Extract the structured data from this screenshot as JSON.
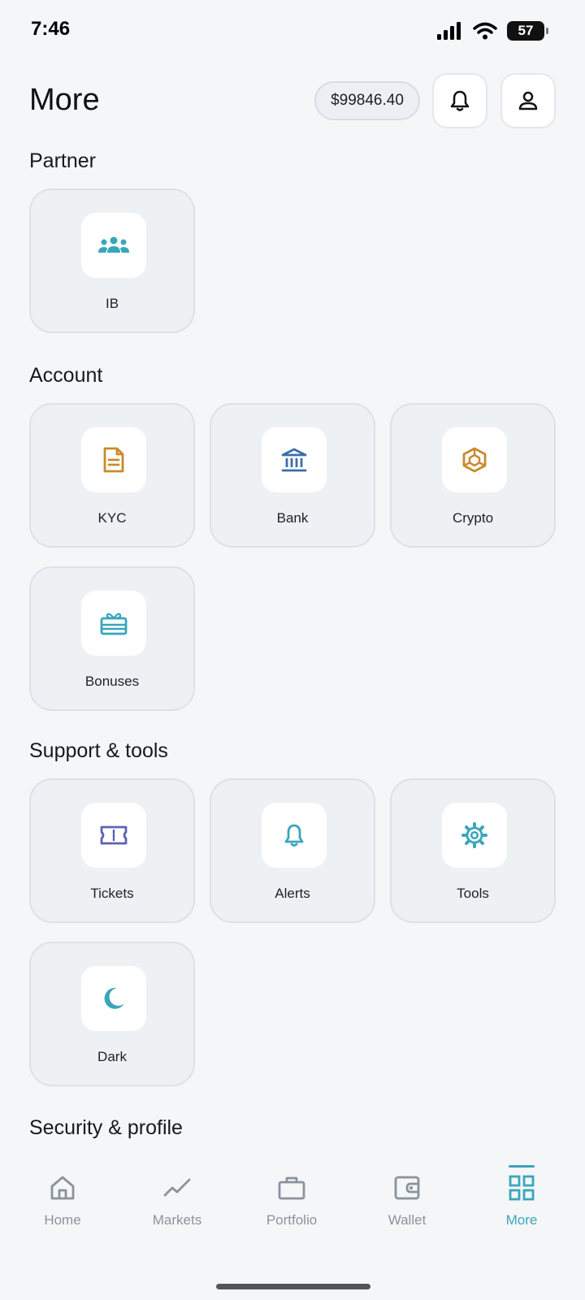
{
  "status": {
    "time": "7:46",
    "battery": "57"
  },
  "header": {
    "title": "More",
    "balance": "$99846.40"
  },
  "sections": {
    "partner": {
      "title": "Partner",
      "items": [
        {
          "label": "IB",
          "icon": "users-icon",
          "color": "#3aa6bb"
        }
      ]
    },
    "account": {
      "title": "Account",
      "items": [
        {
          "label": "KYC",
          "icon": "document-icon",
          "color": "#c98a2b"
        },
        {
          "label": "Bank",
          "icon": "bank-icon",
          "color": "#3a6ea8"
        },
        {
          "label": "Crypto",
          "icon": "cube-icon",
          "color": "#c98a2b"
        },
        {
          "label": "Bonuses",
          "icon": "gift-icon",
          "color": "#3aa6bb"
        }
      ]
    },
    "support": {
      "title": "Support & tools",
      "items": [
        {
          "label": "Tickets",
          "icon": "ticket-icon",
          "color": "#5b63b7"
        },
        {
          "label": "Alerts",
          "icon": "bell-icon",
          "color": "#3aa6bb"
        },
        {
          "label": "Tools",
          "icon": "gear-icon",
          "color": "#3aa6bb"
        },
        {
          "label": "Dark",
          "icon": "moon-icon",
          "color": "#3aa6bb"
        }
      ]
    },
    "security": {
      "title": "Security & profile"
    }
  },
  "nav": {
    "items": [
      {
        "label": "Home",
        "icon": "home-icon"
      },
      {
        "label": "Markets",
        "icon": "chart-line-icon"
      },
      {
        "label": "Portfolio",
        "icon": "briefcase-icon"
      },
      {
        "label": "Wallet",
        "icon": "wallet-icon"
      },
      {
        "label": "More",
        "icon": "grid-icon",
        "active": true
      }
    ]
  },
  "colors": {
    "accent": "#3aa6bb",
    "inactive": "#8a939d"
  }
}
